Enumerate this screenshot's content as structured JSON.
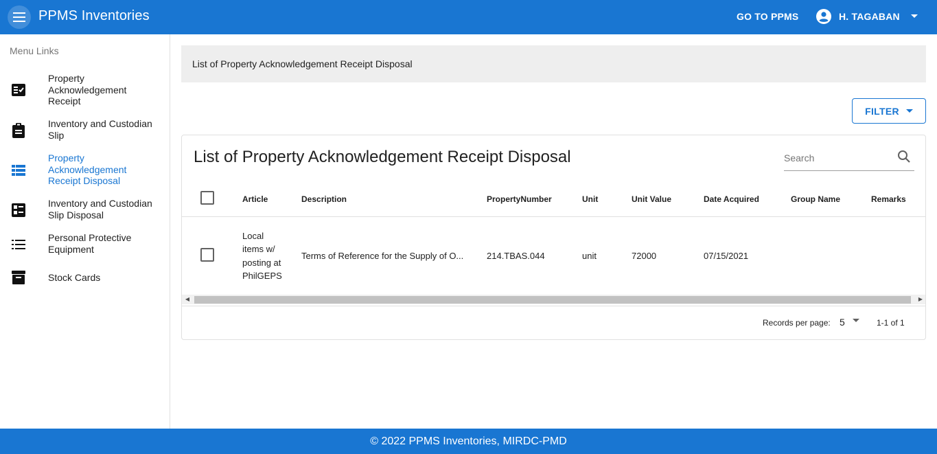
{
  "header": {
    "title": "PPMS Inventories",
    "goto_label": "GO TO PPMS",
    "user_name": "H. TAGABAN"
  },
  "sidebar": {
    "title": "Menu Links",
    "items": [
      {
        "label": "Property Acknowledgement Receipt",
        "icon": "checklist-icon",
        "active": false
      },
      {
        "label": "Inventory and Custodian Slip",
        "icon": "clipboard-icon",
        "active": false
      },
      {
        "label": "Property Acknowledgement Receipt Disposal",
        "icon": "view-list-icon",
        "active": true
      },
      {
        "label": "Inventory and Custodian Slip Disposal",
        "icon": "dashboard-list-icon",
        "active": false
      },
      {
        "label": "Personal Protective Equipment",
        "icon": "list-icon",
        "active": false
      },
      {
        "label": "Stock Cards",
        "icon": "archive-icon",
        "active": false
      }
    ]
  },
  "breadcrumb": "List of Property Acknowledgement Receipt Disposal",
  "filter_label": "FILTER",
  "card": {
    "title": "List of Property Acknowledgement Receipt Disposal",
    "search_placeholder": "Search"
  },
  "table": {
    "columns": [
      "Article",
      "Description",
      "PropertyNumber",
      "Unit",
      "Unit Value",
      "Date Acquired",
      "Group Name",
      "Remarks"
    ],
    "rows": [
      {
        "article": "Local items w/ posting at PhilGEPS",
        "description": "Terms of Reference for the Supply of O...",
        "property_number": "214.TBAS.044",
        "unit": "unit",
        "unit_value": "72000",
        "date_acquired": "07/15/2021",
        "group_name": "",
        "remarks": ""
      }
    ]
  },
  "pagination": {
    "rpp_label": "Records per page:",
    "rpp_value": "5",
    "range": "1-1 of 1"
  },
  "footer": "© 2022 PPMS Inventories, MIRDC-PMD",
  "colors": {
    "primary": "#1976d2",
    "breadcrumb_bg": "#eeeeee"
  }
}
